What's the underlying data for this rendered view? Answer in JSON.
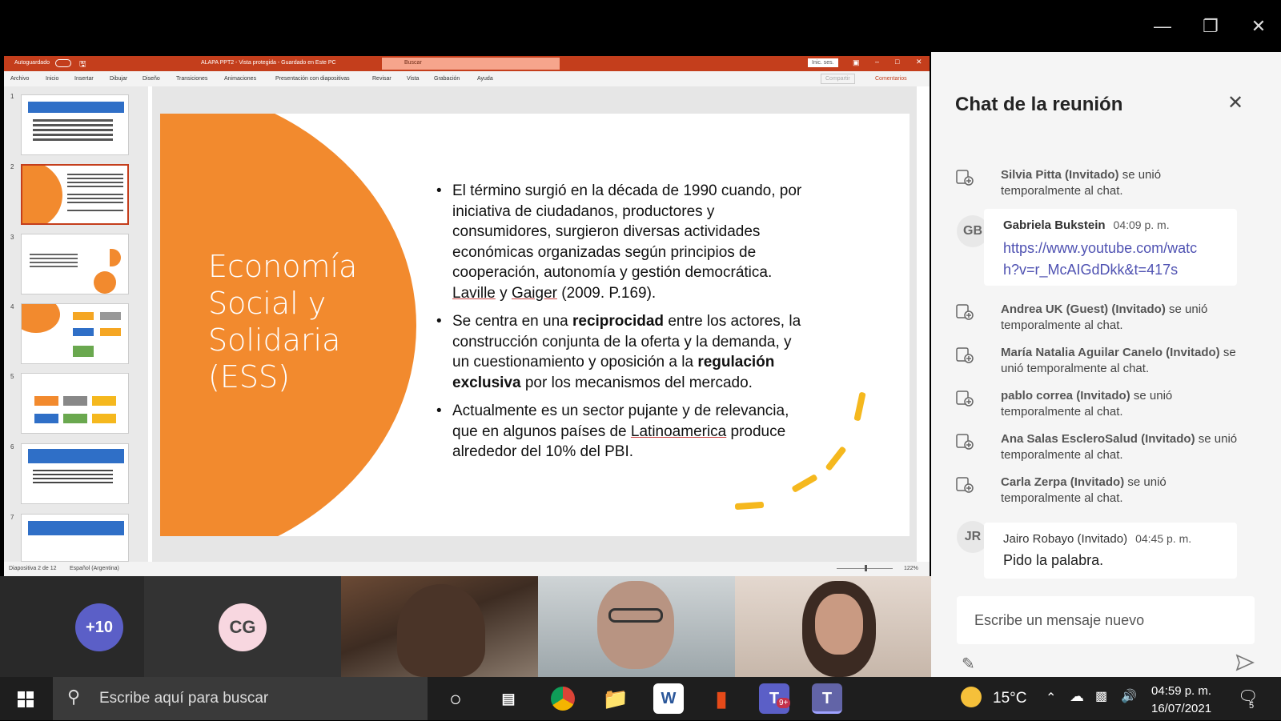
{
  "ppt": {
    "autosave": "Autoguardado",
    "doc_title": "ALAPA PPT2 - Vista protegida - Guardado en Este PC",
    "search": "Buscar",
    "user": "Inic. ses.",
    "menu": [
      "Archivo",
      "Inicio",
      "Insertar",
      "Dibujar",
      "Diseño",
      "Transiciones",
      "Animaciones",
      "Presentación con diapositivas",
      "Revisar",
      "Vista",
      "Grabación",
      "Ayuda"
    ],
    "share_btn": "Compartir",
    "comments_btn": "Comentarios",
    "thumb_numbers": [
      "1",
      "2",
      "3",
      "4",
      "5",
      "6",
      "7"
    ],
    "status_slide": "Diapositiva 2 de 12",
    "status_lang": "Español (Argentina)",
    "zoom": "122%"
  },
  "slide": {
    "title_lines": [
      "Economía",
      "Social y",
      "Solidaria",
      "(ESS)"
    ],
    "b1": {
      "l1": "El término surgió en la década de 1990 cuando, por",
      "l2": "iniciativa de ciudadanos, productores y",
      "l3": "consumidores, surgieron diversas actividades",
      "l4": "económicas organizadas según principios de",
      "l5": "cooperación, autonomía y gestión democrática.",
      "l6a": "Laville",
      "l6b": " y ",
      "l6c": "Gaiger",
      "l6d": " (2009. P.169)."
    },
    "b2": {
      "p1": "Se centra en una ",
      "p2": "reciprocidad",
      "p3": " entre los actores, la",
      "l2": "construcción conjunta de la oferta y la demanda, y",
      "p4": "un cuestionamiento y oposición a la ",
      "p5": "regulación",
      "p6": "exclusiva",
      "p7": " por los mecanismos del mercado."
    },
    "b3": {
      "l1": "Actualmente es un sector pujante y de relevancia,",
      "p1": "que en algunos países de ",
      "p2": "Latinoamerica",
      "p3": " produce",
      "l3": "alrededor del 10% del PBI."
    }
  },
  "participants": {
    "overflow": "+10",
    "cg_initials": "CG"
  },
  "chat": {
    "title": "Chat de la reunión",
    "events": [
      {
        "name": "Silvia Pitta (Invitado)",
        "rest1": " se unió",
        "rest2": "temporalmente al chat."
      },
      {
        "name": "Andrea UK (Guest) (Invitado)",
        "rest1": " se unió",
        "rest2": "temporalmente al chat."
      },
      {
        "name": "María Natalia Aguilar Canelo (Invitado)",
        "rest1": " se",
        "rest2": "unió temporalmente al chat."
      },
      {
        "name": "pablo correa (Invitado)",
        "rest1": " se unió",
        "rest2": "temporalmente al chat."
      },
      {
        "name": "Ana Salas EscleroSalud (Invitado)",
        "rest1": " se unió",
        "rest2": "temporalmente al chat."
      },
      {
        "name": "Carla Zerpa (Invitado)",
        "rest1": " se unió",
        "rest2": "temporalmente al chat."
      }
    ],
    "msg1": {
      "initials": "GB",
      "name": "Gabriela Bukstein",
      "time": "04:09 p. m.",
      "link1": "https://www.youtube.com/watc",
      "link2": "h?v=r_McAIGdDkk&t=417s"
    },
    "msg2": {
      "initials": "JR",
      "name": "Jairo Robayo (Invitado)",
      "time": "04:45 p. m.",
      "text": "Pido la palabra."
    },
    "compose_placeholder": "Escribe un mensaje nuevo"
  },
  "taskbar": {
    "search": "Escribe aquí para buscar",
    "temp": "15°C",
    "time": "04:59 p. m.",
    "date": "16/07/2021",
    "teams_badge": "9+",
    "notif_count": "5"
  },
  "colors": {
    "ppt_red": "#c43e1c",
    "slide_orange": "#f28a2e",
    "teams_purple": "#5b5fc7",
    "accent_yellow": "#f5b81e"
  }
}
